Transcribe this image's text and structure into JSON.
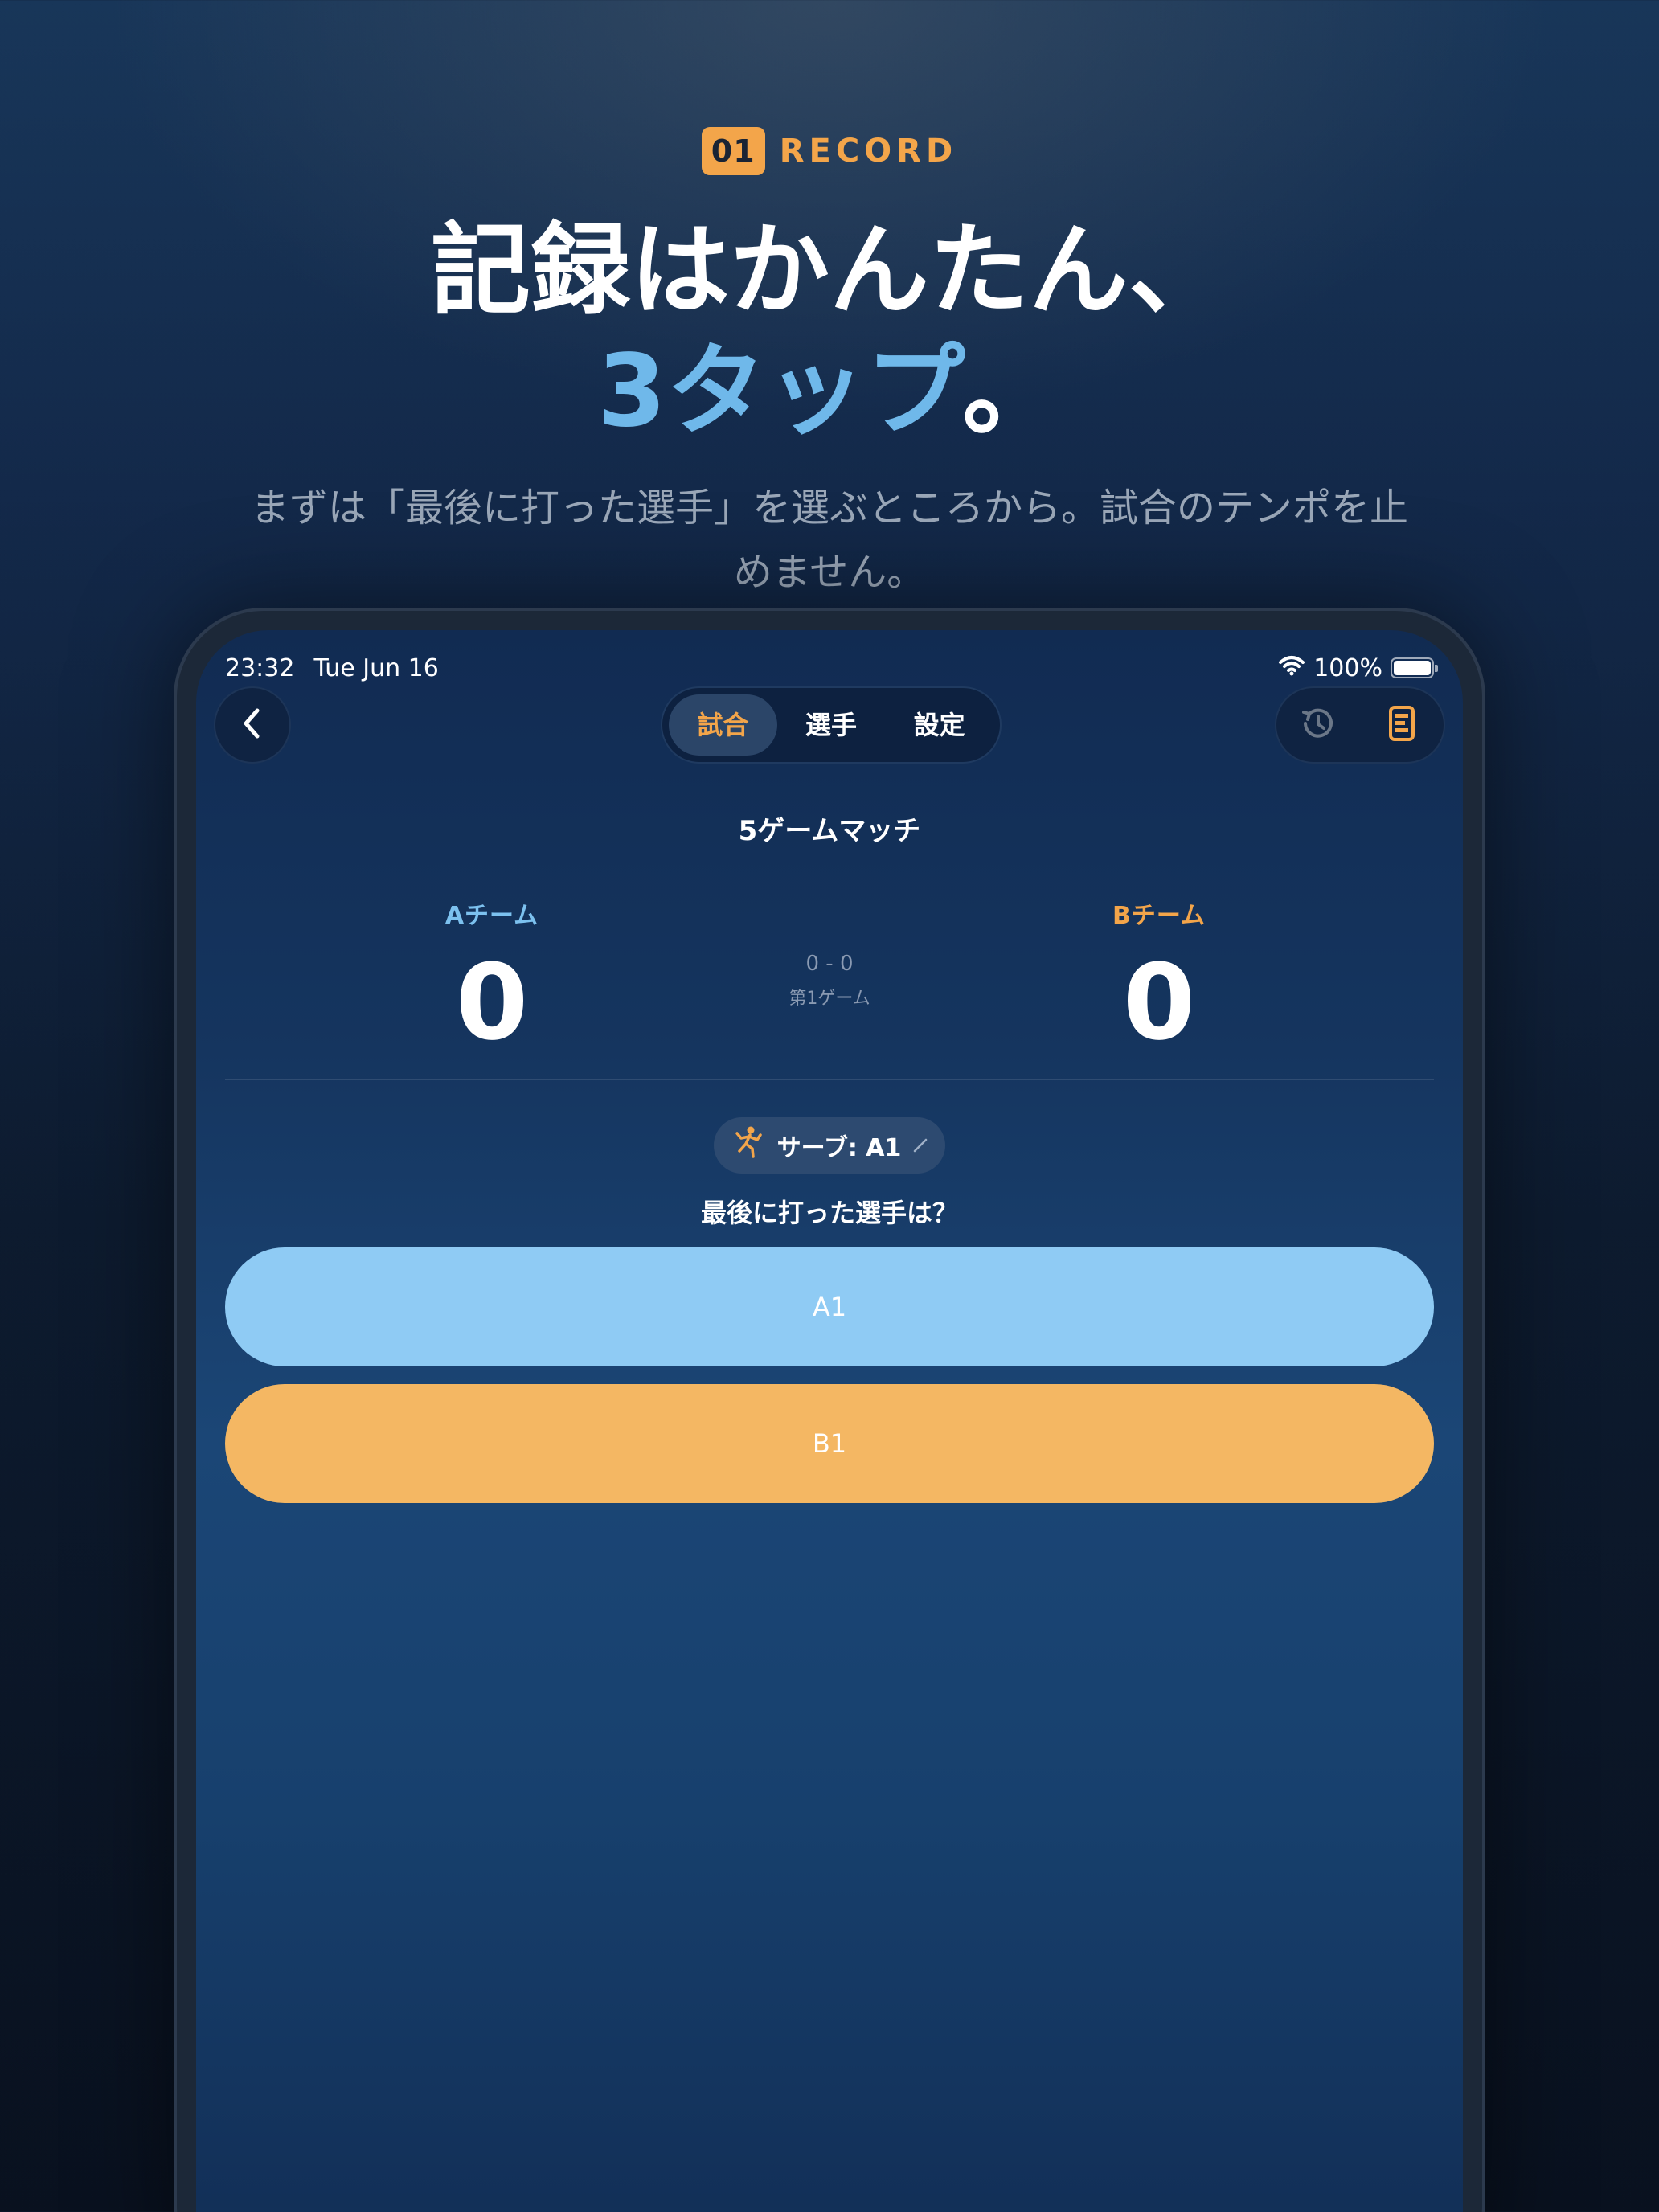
{
  "header": {
    "badge_number": "01",
    "badge_label": "RECORD",
    "headline_line1": "記録はかんたん、",
    "headline_accent": "3タップ",
    "headline_end": "。",
    "subtitle": "まずは「最後に打った選手」を選ぶところから。試合のテンポを止めません。"
  },
  "status_bar": {
    "time": "23:32",
    "date": "Tue Jun 16",
    "battery": "100%"
  },
  "nav": {
    "tabs": [
      {
        "label": "試合",
        "active": true
      },
      {
        "label": "選手",
        "active": false
      },
      {
        "label": "設定",
        "active": false
      }
    ]
  },
  "match": {
    "title": "5ゲームマッチ",
    "team_a": {
      "name": "Aチーム",
      "score": "0"
    },
    "team_b": {
      "name": "Bチーム",
      "score": "0"
    },
    "game_score": "0 - 0",
    "game_number": "第1ゲーム",
    "serve_label": "サーブ: A1",
    "question": "最後に打った選手は？",
    "players": [
      "A1",
      "B1"
    ]
  },
  "colors": {
    "accent_orange": "#f3a54a",
    "accent_blue": "#6fb8ea",
    "player_a": "#8fcbf4",
    "player_b": "#f4b763"
  },
  "icons": [
    "chevron-left-icon",
    "history-icon",
    "scoresheet-icon",
    "wifi-icon",
    "battery-icon",
    "player-serve-icon",
    "edit-pencil-icon"
  ]
}
